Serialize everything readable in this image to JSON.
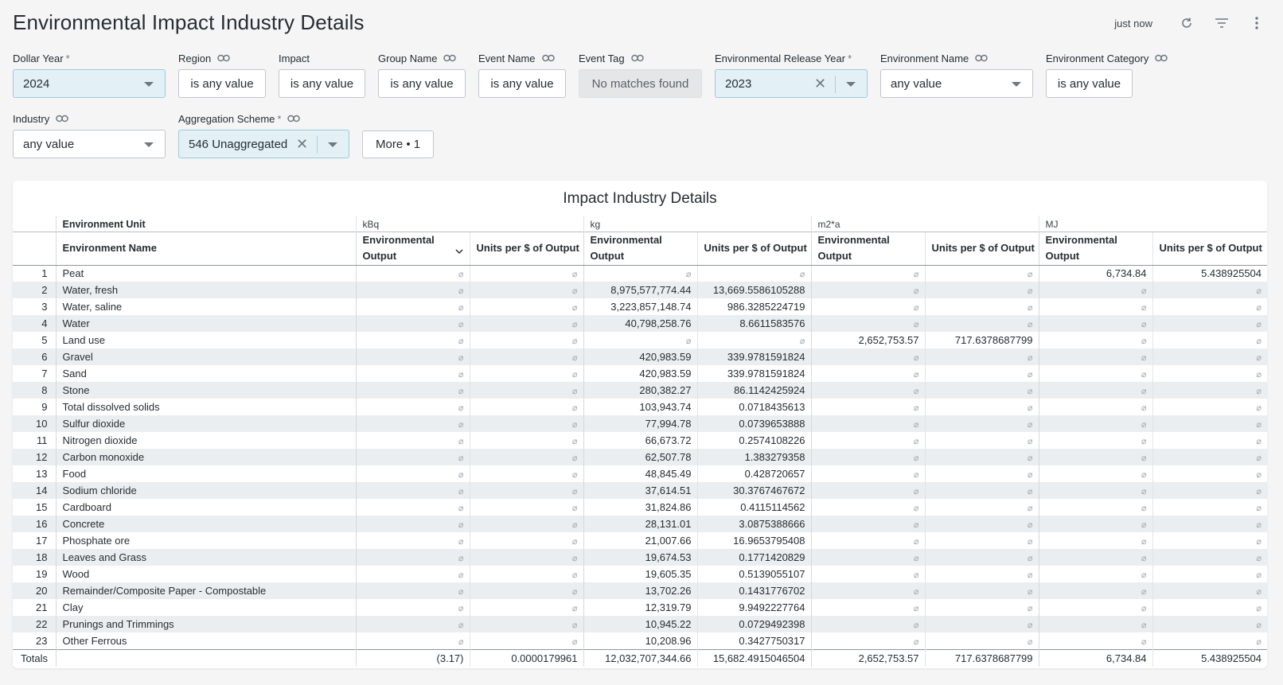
{
  "page": {
    "title": "Environmental Impact Industry Details",
    "refreshed": "just now"
  },
  "filters": {
    "dollar_year": {
      "label": "Dollar Year",
      "req": "*",
      "value": "2024"
    },
    "region": {
      "label": "Region",
      "value": "is any value"
    },
    "impact": {
      "label": "Impact",
      "value": "is any value"
    },
    "group_name": {
      "label": "Group Name",
      "value": "is any value"
    },
    "event_name": {
      "label": "Event Name",
      "value": "is any value"
    },
    "event_tag": {
      "label": "Event Tag",
      "value": "No matches found"
    },
    "env_release_year": {
      "label": "Environmental Release Year",
      "req": "*",
      "value": "2023"
    },
    "environment_name": {
      "label": "Environment Name",
      "value": "any value"
    },
    "environment_category": {
      "label": "Environment Category",
      "value": "is any value"
    },
    "industry": {
      "label": "Industry",
      "value": "any value"
    },
    "aggregation_scheme": {
      "label": "Aggregation Scheme",
      "req": "*",
      "value": "546 Unaggregated"
    },
    "more": "More • 1"
  },
  "table": {
    "title": "Impact Industry Details",
    "unit_header_label": "Environment Unit",
    "units": [
      "kBq",
      "kg",
      "m2*a",
      "MJ"
    ],
    "name_header": "Environment Name",
    "col_output": "Environmental Output",
    "col_units": "Units per $ of Output",
    "null_symbol": "⌀",
    "rows": [
      {
        "i": "1",
        "name": "Peat",
        "v": [
          "",
          "",
          "",
          "",
          "",
          "",
          "6,734.84",
          "5.438925504"
        ]
      },
      {
        "i": "2",
        "name": "Water, fresh",
        "v": [
          "",
          "",
          "8,975,577,774.44",
          "13,669.5586105288",
          "",
          "",
          "",
          ""
        ]
      },
      {
        "i": "3",
        "name": "Water, saline",
        "v": [
          "",
          "",
          "3,223,857,148.74",
          "986.3285224719",
          "",
          "",
          "",
          ""
        ]
      },
      {
        "i": "4",
        "name": "Water",
        "v": [
          "",
          "",
          "40,798,258.76",
          "8.6611583576",
          "",
          "",
          "",
          ""
        ]
      },
      {
        "i": "5",
        "name": "Land use",
        "v": [
          "",
          "",
          "",
          "",
          "2,652,753.57",
          "717.6378687799",
          "",
          ""
        ]
      },
      {
        "i": "6",
        "name": "Gravel",
        "v": [
          "",
          "",
          "420,983.59",
          "339.9781591824",
          "",
          "",
          "",
          ""
        ]
      },
      {
        "i": "7",
        "name": "Sand",
        "v": [
          "",
          "",
          "420,983.59",
          "339.9781591824",
          "",
          "",
          "",
          ""
        ]
      },
      {
        "i": "8",
        "name": "Stone",
        "v": [
          "",
          "",
          "280,382.27",
          "86.1142425924",
          "",
          "",
          "",
          ""
        ]
      },
      {
        "i": "9",
        "name": "Total dissolved solids",
        "v": [
          "",
          "",
          "103,943.74",
          "0.0718435613",
          "",
          "",
          "",
          ""
        ]
      },
      {
        "i": "10",
        "name": "Sulfur dioxide",
        "v": [
          "",
          "",
          "77,994.78",
          "0.0739653888",
          "",
          "",
          "",
          ""
        ]
      },
      {
        "i": "11",
        "name": "Nitrogen dioxide",
        "v": [
          "",
          "",
          "66,673.72",
          "0.2574108226",
          "",
          "",
          "",
          ""
        ]
      },
      {
        "i": "12",
        "name": "Carbon monoxide",
        "v": [
          "",
          "",
          "62,507.78",
          "1.383279358",
          "",
          "",
          "",
          ""
        ]
      },
      {
        "i": "13",
        "name": "Food",
        "v": [
          "",
          "",
          "48,845.49",
          "0.428720657",
          "",
          "",
          "",
          ""
        ]
      },
      {
        "i": "14",
        "name": "Sodium chloride",
        "v": [
          "",
          "",
          "37,614.51",
          "30.3767467672",
          "",
          "",
          "",
          ""
        ]
      },
      {
        "i": "15",
        "name": "Cardboard",
        "v": [
          "",
          "",
          "31,824.86",
          "0.4115114562",
          "",
          "",
          "",
          ""
        ]
      },
      {
        "i": "16",
        "name": "Concrete",
        "v": [
          "",
          "",
          "28,131.01",
          "3.0875388666",
          "",
          "",
          "",
          ""
        ]
      },
      {
        "i": "17",
        "name": "Phosphate ore",
        "v": [
          "",
          "",
          "21,007.66",
          "16.9653795408",
          "",
          "",
          "",
          ""
        ]
      },
      {
        "i": "18",
        "name": "Leaves and Grass",
        "v": [
          "",
          "",
          "19,674.53",
          "0.1771420829",
          "",
          "",
          "",
          ""
        ]
      },
      {
        "i": "19",
        "name": "Wood",
        "v": [
          "",
          "",
          "19,605.35",
          "0.5139055107",
          "",
          "",
          "",
          ""
        ]
      },
      {
        "i": "20",
        "name": "Remainder/Composite Paper - Compostable",
        "v": [
          "",
          "",
          "13,702.26",
          "0.1431776702",
          "",
          "",
          "",
          ""
        ]
      },
      {
        "i": "21",
        "name": "Clay",
        "v": [
          "",
          "",
          "12,319.79",
          "9.9492227764",
          "",
          "",
          "",
          ""
        ]
      },
      {
        "i": "22",
        "name": "Prunings and Trimmings",
        "v": [
          "",
          "",
          "10,945.22",
          "0.0729492398",
          "",
          "",
          "",
          ""
        ]
      },
      {
        "i": "23",
        "name": "Other Ferrous",
        "v": [
          "",
          "",
          "10,208.96",
          "0.3427750317",
          "",
          "",
          "",
          ""
        ]
      }
    ],
    "totals": {
      "label": "Totals",
      "v": [
        "(3.17)",
        "0.0000179961",
        "12,032,707,344.66",
        "15,682.4915046504",
        "2,652,753.57",
        "717.6378687799",
        "6,734.84",
        "5.438925504"
      ]
    }
  }
}
